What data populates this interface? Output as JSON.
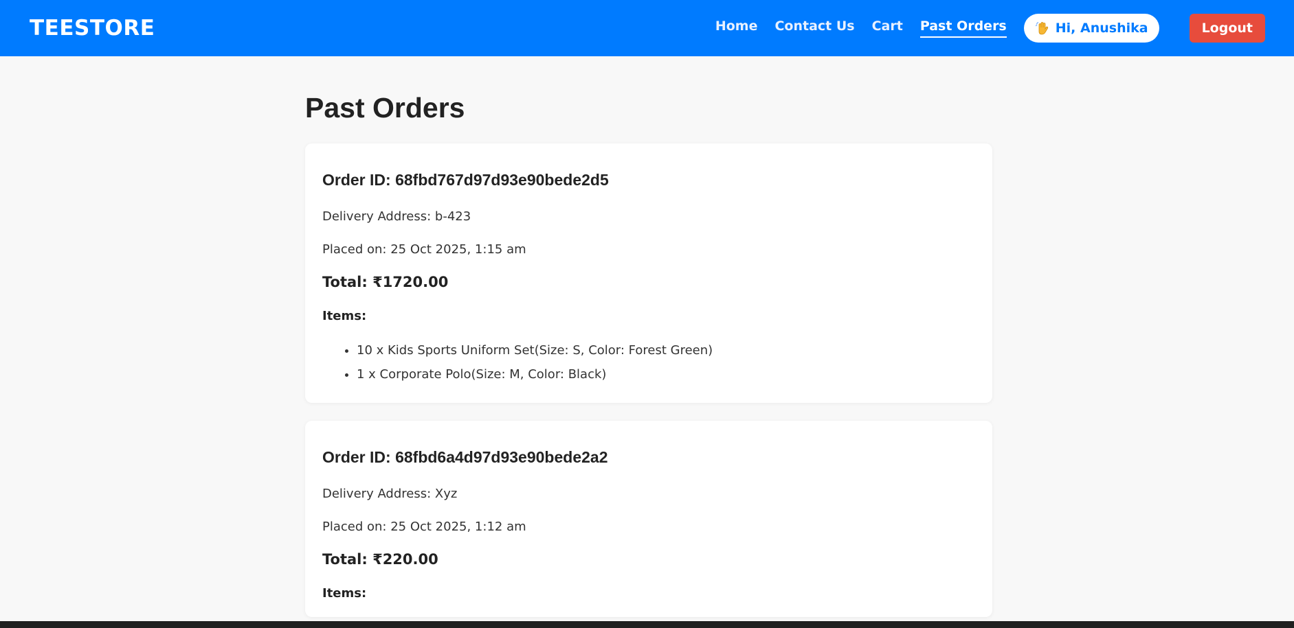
{
  "header": {
    "brand": "TEESTORE",
    "nav": [
      {
        "label": "Home"
      },
      {
        "label": "Contact Us"
      },
      {
        "label": "Cart"
      },
      {
        "label": "Past Orders"
      }
    ],
    "greeting": "Hi, Anushika",
    "greeting_icon": "waving-hand-icon",
    "logout_label": "Logout",
    "accent_color": "#007bff",
    "logout_color": "#e74c3c"
  },
  "main": {
    "title": "Past Orders",
    "orders": [
      {
        "id_text": "Order ID: 68fbd767d97d93e90bede2d5",
        "address_text": "Delivery Address: b-423",
        "placed_text": "Placed on: 25 Oct 2025, 1:15 am",
        "total_text": "Total: ₹1720.00",
        "items_label": "Items:",
        "items": [
          "10 x Kids Sports Uniform Set(Size: S, Color: Forest Green)",
          "1 x Corporate Polo(Size: M, Color: Black)"
        ]
      },
      {
        "id_text": "Order ID: 68fbd6a4d97d93e90bede2a2",
        "address_text": "Delivery Address: Xyz",
        "placed_text": "Placed on: 25 Oct 2025, 1:12 am",
        "total_text": "Total: ₹220.00",
        "items_label": "Items:"
      }
    ]
  }
}
